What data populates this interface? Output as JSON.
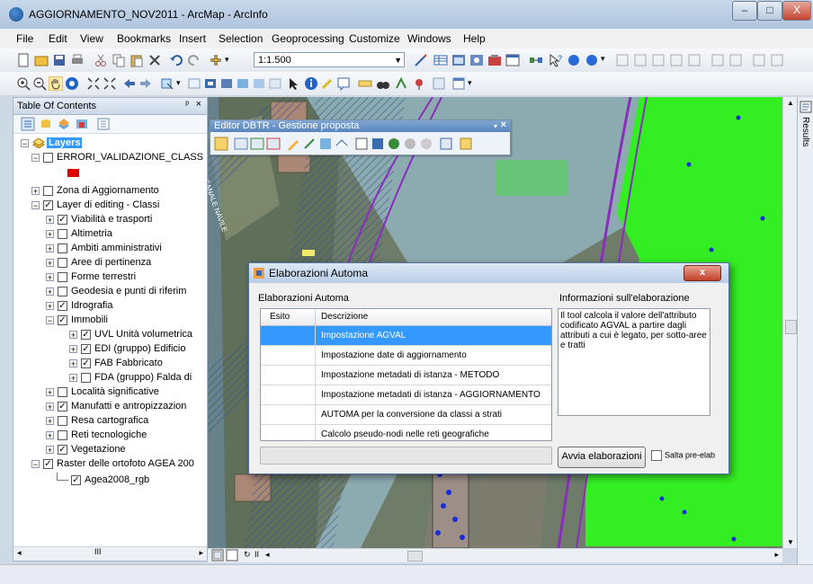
{
  "window": {
    "title": "AGGIORNAMENTO_NOV2011 - ArcMap - ArcInfo",
    "minimize_label": "–",
    "maximize_label": "□",
    "close_label": "X"
  },
  "menu": [
    "File",
    "Edit",
    "View",
    "Bookmarks",
    "Insert",
    "Selection",
    "Geoprocessing",
    "Customize",
    "Windows",
    "Help"
  ],
  "toolbar": {
    "scale_value": "1:1.500"
  },
  "toc": {
    "title": "Table Of Contents",
    "pin": "ᵖ",
    "close": "×",
    "items": [
      {
        "label": "Layers",
        "checked": null,
        "expander": "−",
        "indent": 0
      },
      {
        "label": "ERRORI_VALIDAZIONE_CLASS",
        "checked": false,
        "expander": "−",
        "indent": 1
      },
      {
        "label": "Zona di Aggiornamento",
        "checked": false,
        "expander": "+",
        "indent": 1
      },
      {
        "label": "Layer di editing - Classi",
        "checked": true,
        "expander": "−",
        "indent": 1
      },
      {
        "label": "Viabilità e trasporti",
        "checked": true,
        "expander": "+",
        "indent": 2
      },
      {
        "label": "Altimetria",
        "checked": false,
        "expander": "+",
        "indent": 2
      },
      {
        "label": "Ambiti amministrativi",
        "checked": false,
        "expander": "+",
        "indent": 2
      },
      {
        "label": "Aree di pertinenza",
        "checked": false,
        "expander": "+",
        "indent": 2
      },
      {
        "label": "Forme terrestri",
        "checked": false,
        "expander": "+",
        "indent": 2
      },
      {
        "label": "Geodesia e punti di riferim",
        "checked": false,
        "expander": "+",
        "indent": 2
      },
      {
        "label": "Idrografia",
        "checked": true,
        "expander": "+",
        "indent": 2
      },
      {
        "label": "Immobili",
        "checked": true,
        "expander": "−",
        "indent": 2
      },
      {
        "label": "UVL Unità volumetrica",
        "checked": true,
        "expander": "+",
        "indent": 3
      },
      {
        "label": "EDI (gruppo) Edificio",
        "checked": true,
        "expander": "+",
        "indent": 3
      },
      {
        "label": "FAB Fabbricato",
        "checked": true,
        "expander": "+",
        "indent": 3
      },
      {
        "label": "FDA (gruppo) Falda di",
        "checked": false,
        "expander": "+",
        "indent": 3
      },
      {
        "label": "Località significative",
        "checked": false,
        "expander": "+",
        "indent": 2
      },
      {
        "label": "Manufatti e antropizzazion",
        "checked": true,
        "expander": "+",
        "indent": 2
      },
      {
        "label": "Resa cartografica",
        "checked": false,
        "expander": "+",
        "indent": 2
      },
      {
        "label": "Reti tecnologiche",
        "checked": false,
        "expander": "+",
        "indent": 2
      },
      {
        "label": "Vegetazione",
        "checked": true,
        "expander": "+",
        "indent": 2
      },
      {
        "label": "Raster delle ortofoto AGEA 200",
        "checked": true,
        "expander": "−",
        "indent": 1
      },
      {
        "label": "Agea2008_rgb",
        "checked": null,
        "expander": null,
        "indent": 2
      }
    ]
  },
  "editor_toolbar": {
    "title": "Editor DBTR - Gestione proposta",
    "close": "×"
  },
  "map": {
    "road_label": "CANALE NAVILE"
  },
  "side_panel": {
    "label": "Results"
  },
  "dialog": {
    "title": "Elaborazioni Automa",
    "close": "x",
    "left_label": "Elaborazioni Automa",
    "right_label": "Informazioni sull'elaborazione",
    "columns": [
      "Esito",
      "Descrizione"
    ],
    "rows": [
      "Impostazione AGVAL",
      "Impostazione date di aggiornamento",
      "Impostazione metadati di istanza - METODO",
      "Impostazione metadati di istanza - AGGIORNAMENTO",
      "AUTOMA per la conversione da classi a strati",
      "Calcolo pseudo-nodi nelle reti geografiche"
    ],
    "selected_index": 0,
    "info_text": "Il tool calcola il valore dell'attributo codificato AGVAL a partire dagli attributi a cui è legato, per sotto-aree e tratti",
    "run_button": "Avvia elaborazioni",
    "skip_label": "Salta pre-elab"
  },
  "colors": {
    "selection": "#3399ff",
    "polygon_green": "#33ee22",
    "canal": "#8fb0b8",
    "road_line": "#8a2dbd"
  }
}
